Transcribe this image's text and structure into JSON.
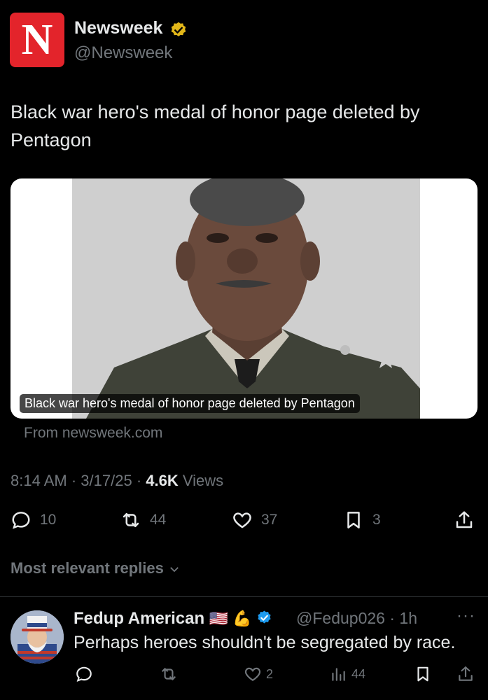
{
  "tweet": {
    "logo_letter": "N",
    "author_name": "Newsweek",
    "author_handle": "@Newsweek",
    "text": "Black war hero's medal of honor page deleted by Pentagon",
    "card_caption": "Black war hero's medal of honor page deleted by Pentagon",
    "card_source": "From newsweek.com",
    "time": "8:14 AM",
    "date": "3/17/25",
    "views_count": "4.6K",
    "views_label": "Views",
    "sep": "·"
  },
  "actions": {
    "replies": "10",
    "reposts": "44",
    "likes": "37",
    "bookmarks": "3"
  },
  "replies_section": {
    "label": "Most relevant replies"
  },
  "reply": {
    "name": "Fedup American",
    "emojis": "🇺🇸 💪",
    "handle": "@Fedup026",
    "time": "1h",
    "sep": "·",
    "text": "Perhaps heroes shouldn't be segregated by race.",
    "likes": "2",
    "views": "44",
    "more": "···"
  },
  "colors": {
    "brand_red": "#e3242b",
    "verified_gold": "#e2b719",
    "verified_blue": "#1d9bf0",
    "muted": "#71767b"
  }
}
